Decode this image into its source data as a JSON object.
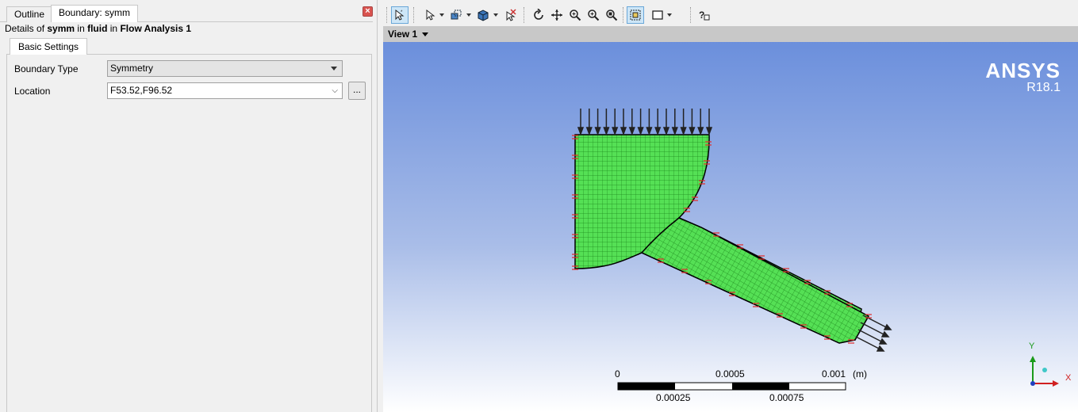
{
  "panel_tabs": {
    "outline": "Outline",
    "boundary": "Boundary: symm"
  },
  "details": {
    "prefix": "Details of",
    "object": "symm",
    "in1": "in",
    "domain": "fluid",
    "in2": "in",
    "analysis": "Flow Analysis 1"
  },
  "settings": {
    "tab": "Basic Settings",
    "boundary_type_label": "Boundary Type",
    "boundary_type_value": "Symmetry",
    "location_label": "Location",
    "location_value": "F53.52,F96.52",
    "browse_label": "..."
  },
  "view": {
    "title": "View 1"
  },
  "branding": {
    "name": "ANSYS",
    "version": "R18.1"
  },
  "scale": {
    "t0": "0",
    "t1": "0.0005",
    "t2": "0.001",
    "unit": "(m)",
    "b1": "0.00025",
    "b2": "0.00075"
  },
  "triad": {
    "y": "Y",
    "x": "X"
  },
  "colors": {
    "mesh_fill": "#55e055",
    "mesh_line": "#1e8a1e",
    "marker": "#e03030",
    "close": "#d9534f"
  },
  "icons": [
    "cursor-select-icon",
    "select-mode-icon",
    "box-select-icon",
    "solid-box-icon",
    "pick-icon",
    "rotate-icon",
    "pan-icon",
    "zoom-icon",
    "zoom-box-icon",
    "zoom-fit-icon",
    "fit-selection-icon",
    "viewport-icon",
    "help-icon"
  ]
}
